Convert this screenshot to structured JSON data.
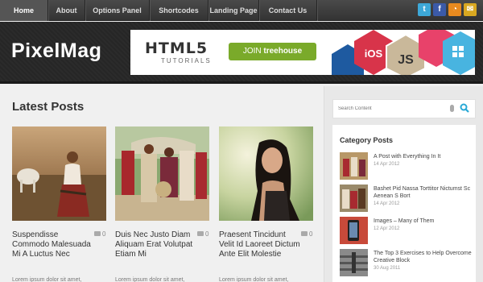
{
  "nav": {
    "items": [
      {
        "label": "Home",
        "active": true
      },
      {
        "label": "About"
      },
      {
        "label": "Options Panel"
      },
      {
        "label": "Shortcodes"
      },
      {
        "label": "Landing Page"
      },
      {
        "label": "Contact Us"
      }
    ],
    "social": [
      {
        "icon": "twitter-icon",
        "glyph": "t",
        "color": "#3da8d8"
      },
      {
        "icon": "facebook-icon",
        "glyph": "f",
        "color": "#3b5aa8"
      },
      {
        "icon": "rss-icon",
        "glyph": "◔",
        "color": "#e88a1f"
      },
      {
        "icon": "mail-icon",
        "glyph": "✉",
        "color": "#d9a821"
      }
    ]
  },
  "header": {
    "logo": "PixelMag",
    "banner": {
      "title": "HTML5",
      "subtitle": "TUTORIALS",
      "button_prefix": "JOIN",
      "button_brand": "treehouse",
      "hex_labels": [
        "iOS",
        "JS"
      ]
    }
  },
  "main": {
    "section_title": "Latest Posts",
    "posts": [
      {
        "title": "Suspendisse Commodo Malesuada Mi A Luctus Nec",
        "comments": "0",
        "excerpt": "Lorem ipsum dolor sit amet,"
      },
      {
        "title": "Duis Nec Justo Diam Aliquam Erat Volutpat Etiam Mi",
        "comments": "0",
        "excerpt": "Lorem ipsum dolor sit amet, consectetur adipiscing elit."
      },
      {
        "title": "Praesent Tincidunt Velit Id Laoreet Dictum Ante Elit Molestie",
        "comments": "0",
        "excerpt": "Lorem ipsum dolor sit amet,"
      }
    ]
  },
  "sidebar": {
    "search_placeholder": "Search Content",
    "category_title": "Category Posts",
    "items": [
      {
        "title": "A Post with Everything In It",
        "date": "14 Apr 2012"
      },
      {
        "title": "Bashet Pid Nassa Torttitor Nictumst Sc Aenean S Bort",
        "date": "14 Apr 2012"
      },
      {
        "title": "Images – Many of Them",
        "date": "12 Apr 2012"
      },
      {
        "title": "The Top 3 Exercises to Help Overcome Creative Block",
        "date": "30 Aug 2011"
      }
    ]
  },
  "colors": {
    "accent_green": "#7aaa2a",
    "search_icon": "#29a9d6",
    "header_bg": "#2a2a2a"
  }
}
